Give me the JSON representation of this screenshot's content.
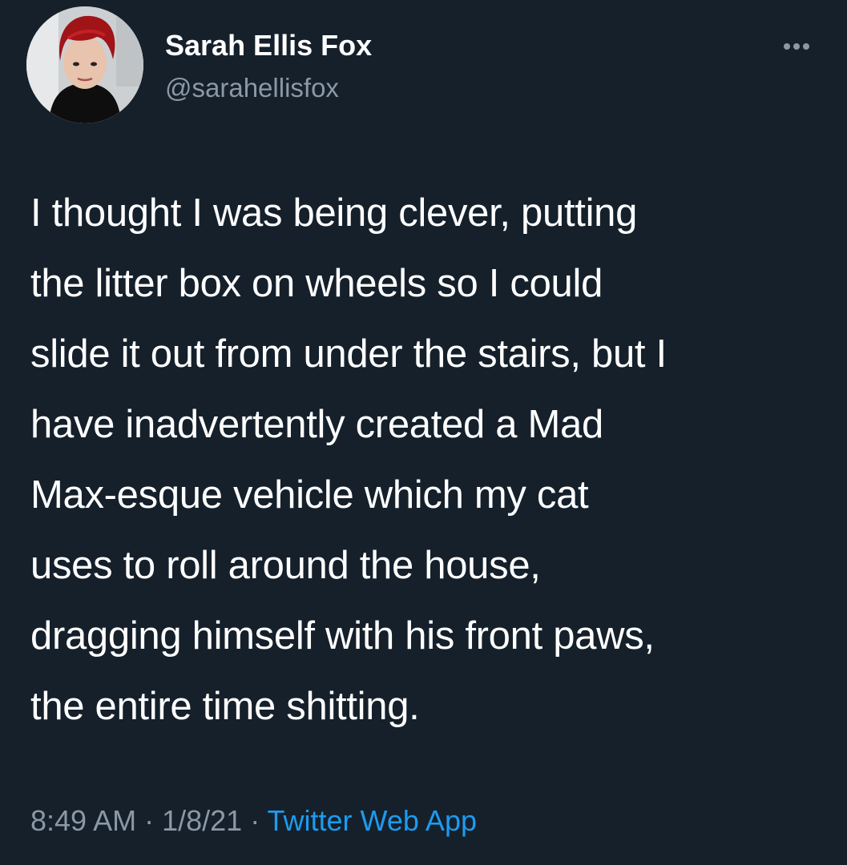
{
  "author": {
    "name": "Sarah Ellis Fox",
    "handle": "@sarahellisfox"
  },
  "more_icon": "more-horizontal-icon",
  "tweet": {
    "lines": [
      "I thought I was being clever, putting",
      "the litter box on wheels so I could",
      "slide it out from under the stairs, but I",
      "have inadvertently created a Mad",
      "Max-esque vehicle which my cat",
      "uses to roll around the house,",
      "dragging himself with his front paws,",
      "the entire time shitting."
    ]
  },
  "meta": {
    "time": "8:49 AM",
    "separator": " · ",
    "date": "1/8/21",
    "source": "Twitter Web App"
  },
  "colors": {
    "background": "#15202b",
    "text": "#ffffff",
    "secondary": "#8b98a5",
    "link": "#1d9bf0"
  }
}
